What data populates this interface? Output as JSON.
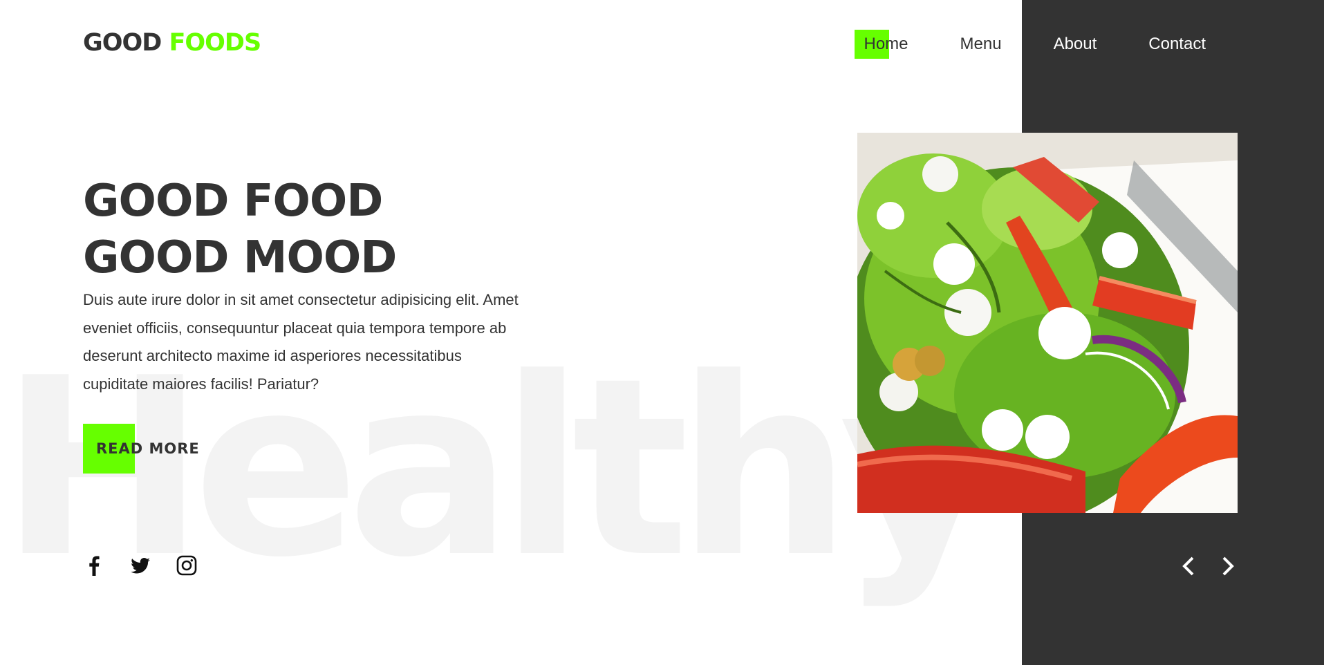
{
  "colors": {
    "accent": "#66ff00",
    "text": "#333333",
    "dark_panel": "#333333",
    "watermark": "#f3f3f3"
  },
  "header": {
    "logo_part1": "GOOD",
    "logo_part2": "FOODS",
    "nav": [
      {
        "label": "Home",
        "active": true
      },
      {
        "label": "Menu"
      },
      {
        "label": "About"
      },
      {
        "label": "Contact"
      }
    ]
  },
  "hero": {
    "watermark": "Healthy",
    "title_line1": "GOOD FOOD",
    "title_line2": "GOOD MOOD",
    "text": "Duis aute irure dolor in sit amet consectetur adipisicing elit. Amet eveniet officiis, consequuntur placeat quia tempora tempore ab deserunt architecto maxime id asperiores necessitatibus cupiditate maiores facilis! Pariatur?",
    "button_label": "READ MORE",
    "image_icon": "salad-photo"
  },
  "social": {
    "icons": [
      "facebook-icon",
      "twitter-icon",
      "instagram-icon"
    ]
  },
  "slider": {
    "prev_icon": "chevron-left-icon",
    "next_icon": "chevron-right-icon"
  }
}
